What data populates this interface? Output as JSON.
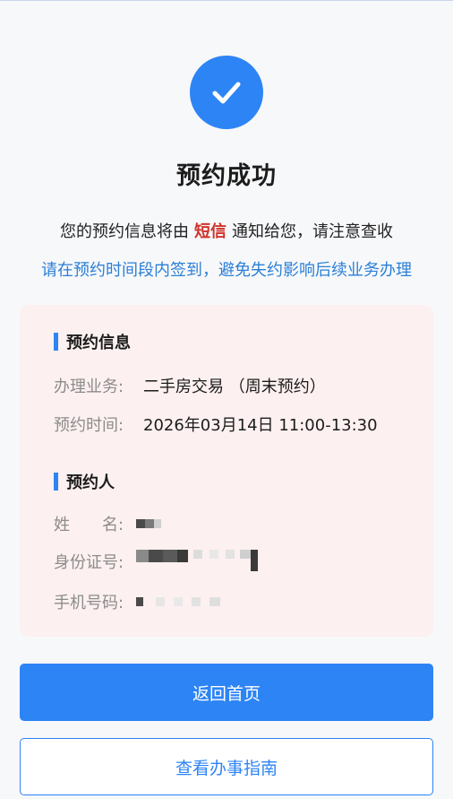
{
  "status": {
    "title": "预约成功",
    "notice_prefix": "您的预约信息将由",
    "notice_highlight": "短信",
    "notice_suffix": "通知给您，请注意查收",
    "tip": "请在预约时间段内签到，避免失约影响后续业务办理",
    "icon": "check-circle-icon",
    "accent_color": "#2d84f5",
    "highlight_color": "#d0322a",
    "tip_color": "#2b7fd6"
  },
  "booking_info": {
    "heading": "预约信息",
    "business_label": "办理业务:",
    "business_value": "二手房交易 （周末预约）",
    "time_label": "预约时间:",
    "time_value": "2026年03月14日 11:00-13:30"
  },
  "person": {
    "heading": "预约人",
    "name_label": "姓　　名:",
    "id_label": "身份证号:",
    "phone_label": "手机号码:"
  },
  "actions": {
    "home_label": "返回首页",
    "guide_label": "查看办事指南"
  }
}
